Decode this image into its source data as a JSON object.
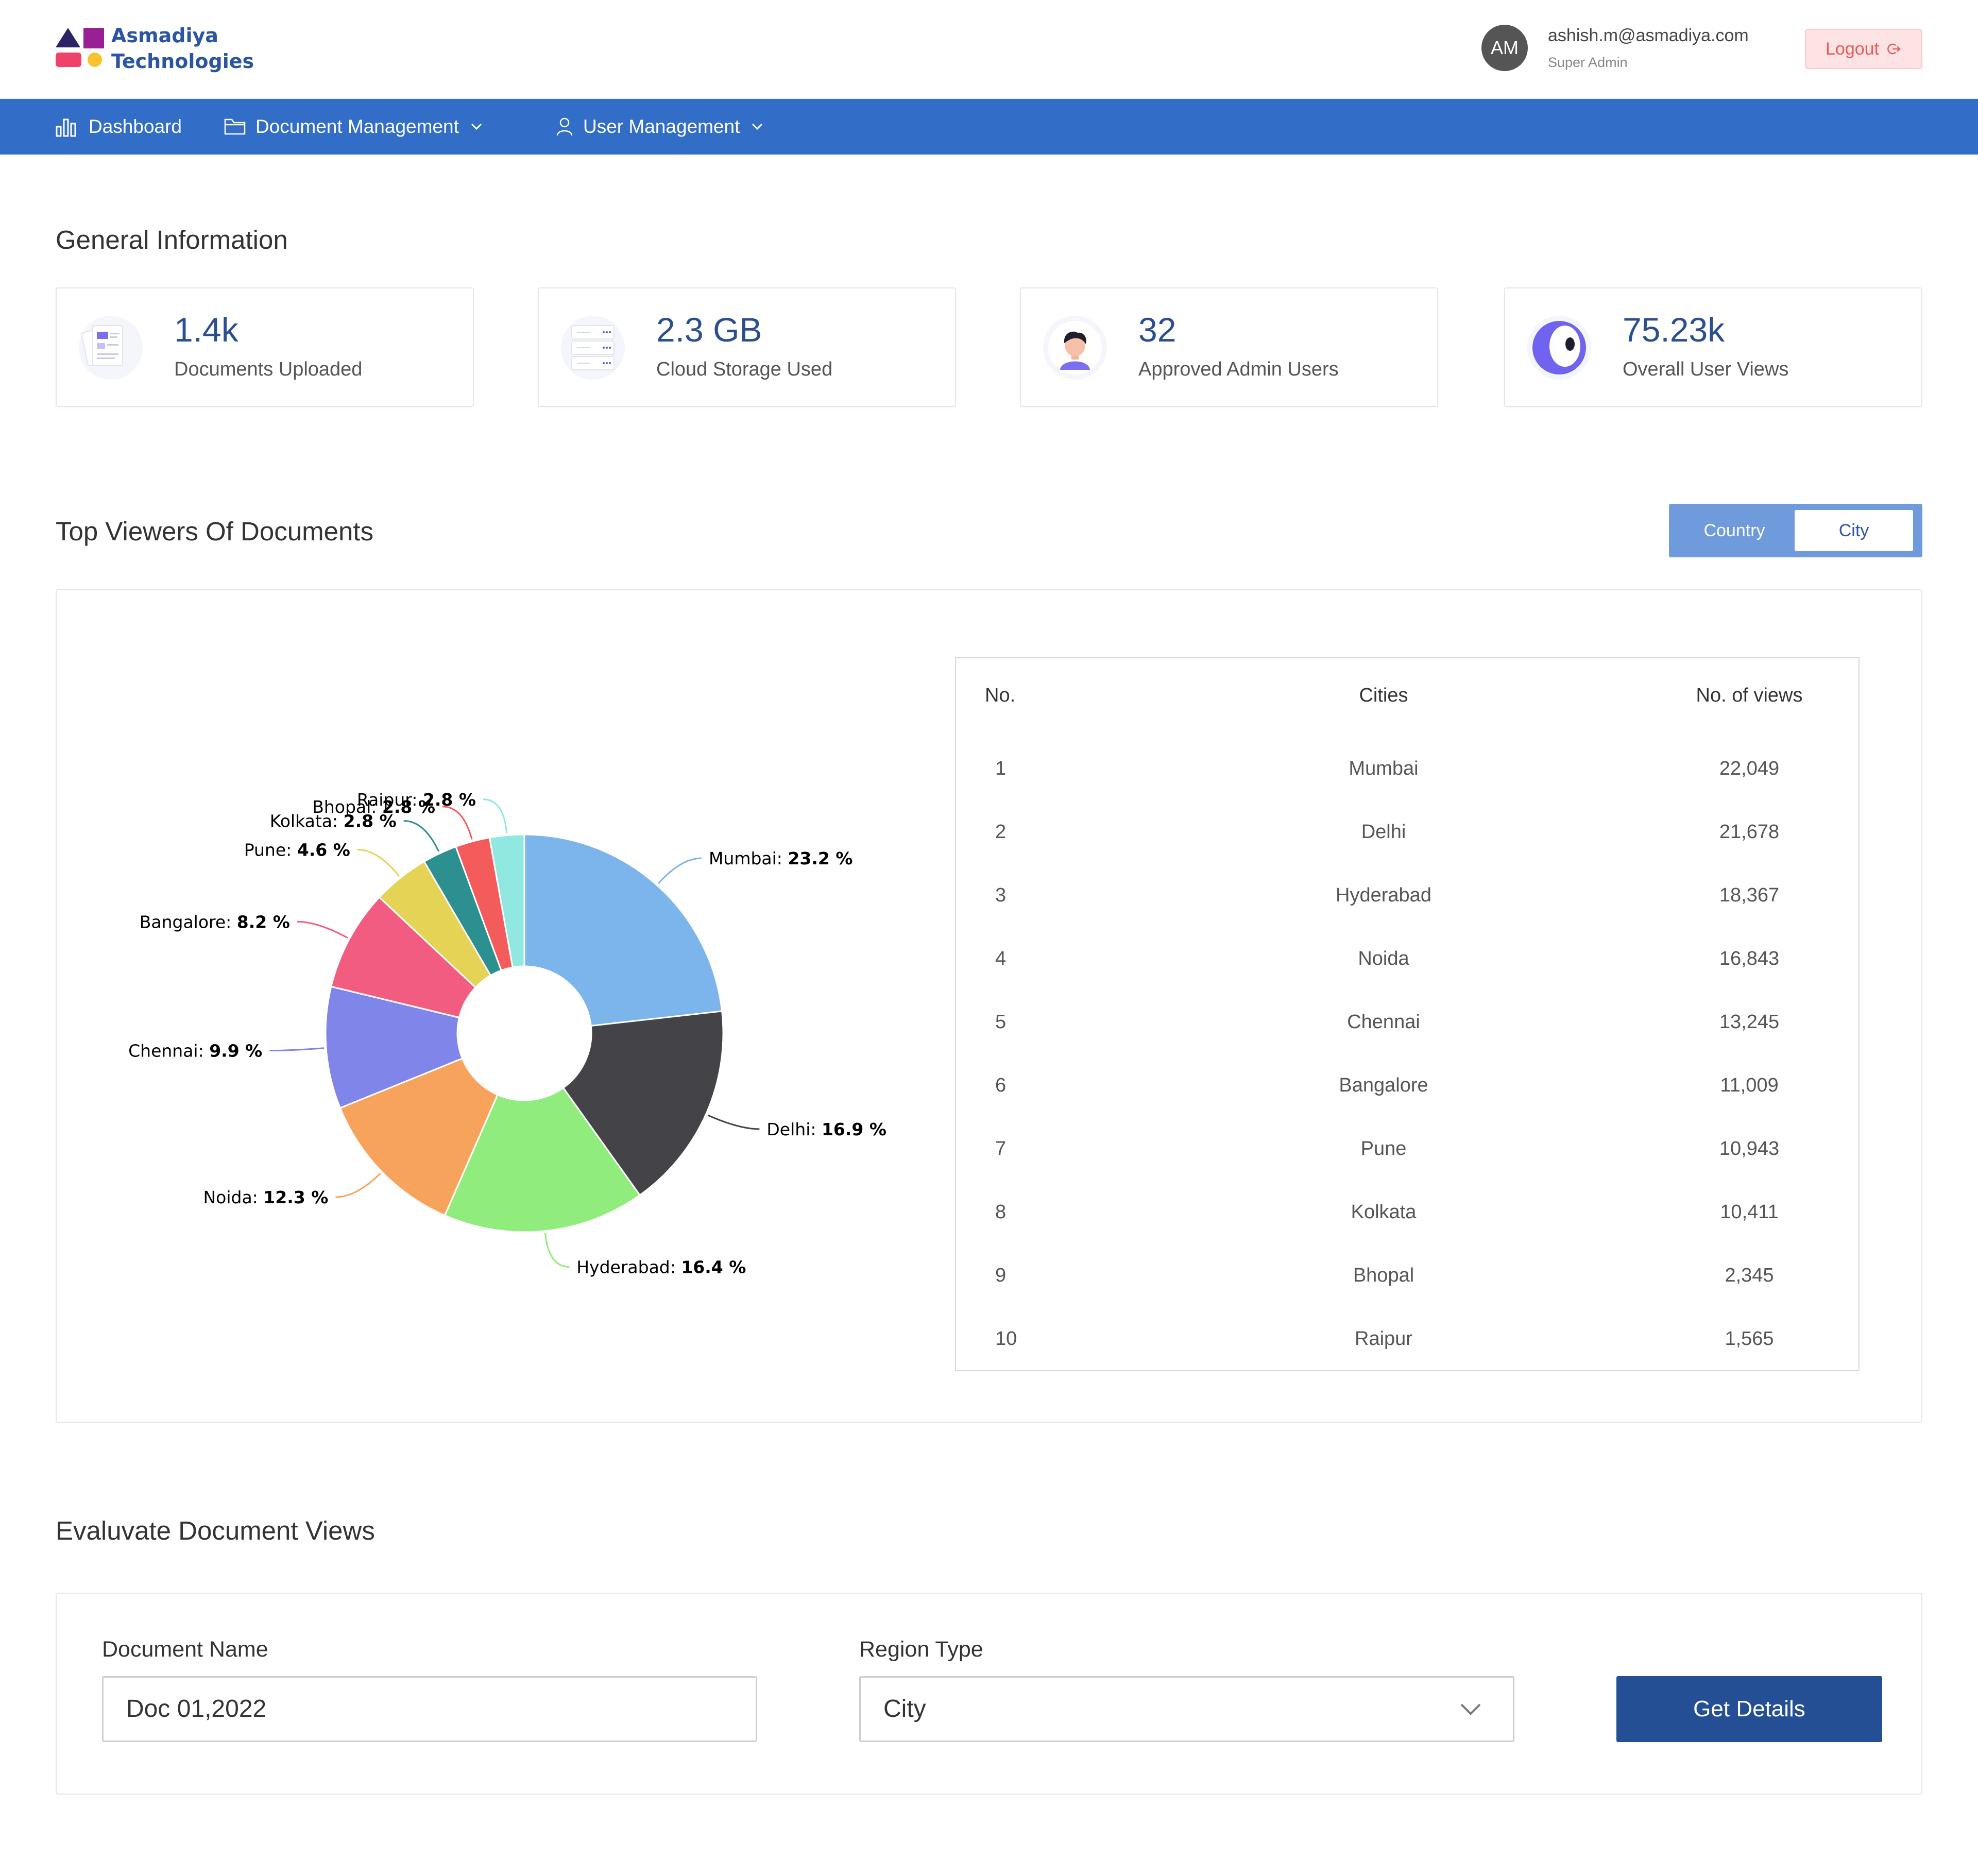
{
  "brand": {
    "name_line1": "Asmadiya",
    "name_line2": "Technologies"
  },
  "user": {
    "initials": "AM",
    "email": "ashish.m@asmadiya.com",
    "role": "Super Admin",
    "logout_label": "Logout"
  },
  "nav": {
    "dashboard": "Dashboard",
    "documents": "Document Management",
    "users": "User Management"
  },
  "general": {
    "title": "General Information",
    "stats": [
      {
        "value": "1.4k",
        "label": "Documents Uploaded",
        "icon": "documents-icon"
      },
      {
        "value": "2.3 GB",
        "label": "Cloud Storage Used",
        "icon": "server-icon"
      },
      {
        "value": "32",
        "label": "Approved Admin Users",
        "icon": "admin-user-icon"
      },
      {
        "value": "75.23k",
        "label": "Overall User Views",
        "icon": "eye-icon"
      }
    ]
  },
  "viewers": {
    "title": "Top Viewers Of Documents",
    "toggle": {
      "country": "Country",
      "city": "City",
      "selected": "City"
    },
    "table": {
      "headers": [
        "No.",
        "Cities",
        "No. of views"
      ],
      "rows": [
        [
          "1",
          "Mumbai",
          "22,049"
        ],
        [
          "2",
          "Delhi",
          "21,678"
        ],
        [
          "3",
          "Hyderabad",
          "18,367"
        ],
        [
          "4",
          "Noida",
          "16,843"
        ],
        [
          "5",
          "Chennai",
          "13,245"
        ],
        [
          "6",
          "Bangalore",
          "11,009"
        ],
        [
          "7",
          "Pune",
          "10,943"
        ],
        [
          "8",
          "Kolkata",
          "10,411"
        ],
        [
          "9",
          "Bhopal",
          "2,345"
        ],
        [
          "10",
          "Raipur",
          "1,565"
        ]
      ]
    }
  },
  "chart_data": {
    "type": "pie",
    "donut": true,
    "categories": [
      "Mumbai",
      "Delhi",
      "Hyderabad",
      "Noida",
      "Chennai",
      "Bangalore",
      "Pune",
      "Kolkata",
      "Bhopal",
      "Raipur"
    ],
    "values": [
      23.2,
      16.9,
      16.4,
      12.3,
      9.9,
      8.2,
      4.6,
      2.8,
      2.8,
      2.8
    ],
    "unit": "%",
    "colors": [
      "#7cb5ec",
      "#434348",
      "#90ed7d",
      "#f7a35c",
      "#8085e9",
      "#f15c80",
      "#e4d354",
      "#2b908f",
      "#f45b5b",
      "#91e8e1"
    ],
    "title": "",
    "legend": "none"
  },
  "evaluate": {
    "title": "Evaluvate Document Views",
    "doc_label": "Document Name",
    "doc_value": "Doc 01,2022",
    "region_label": "Region Type",
    "region_value": "City",
    "button_label": "Get Details"
  },
  "colors": {
    "nav": "#326ec7",
    "accent": "#2b4f8e",
    "button": "#244f94",
    "logout_bg": "#fde3e3",
    "logout_text": "#e65a5a"
  }
}
